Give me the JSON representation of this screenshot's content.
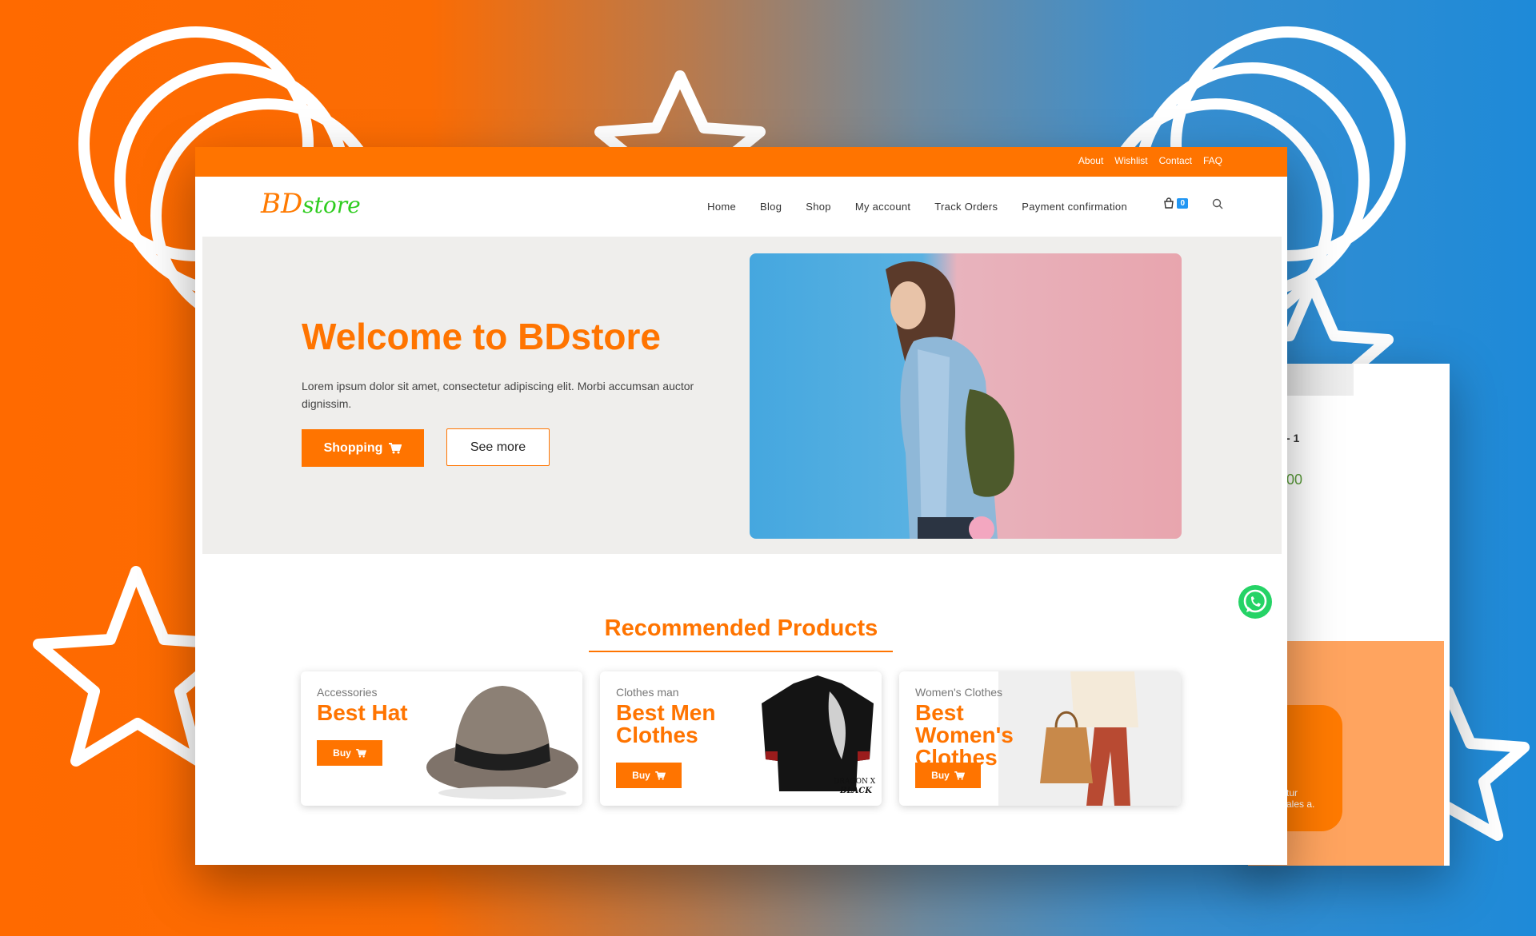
{
  "colors": {
    "brand": "#ff7400",
    "badge": "#2196f3",
    "logo_green": "#2ecc1f",
    "hero_bg": "#efeeec"
  },
  "topbar": {
    "links": [
      "About",
      "Wishlist",
      "Contact",
      "FAQ"
    ]
  },
  "logo": {
    "part1": "BD",
    "part2": "store"
  },
  "nav": {
    "items": [
      "Home",
      "Blog",
      "Shop",
      "My account",
      "Track Orders",
      "Payment confirmation"
    ],
    "cart_count": "0",
    "cart_icon": "shopping-bag-icon",
    "search_icon": "search-icon"
  },
  "hero": {
    "title": "Welcome to BDstore",
    "text": "Lorem ipsum dolor sit amet, consectetur adipiscing elit. Morbi accumsan auctor dignissim.",
    "shop_label": "Shopping",
    "more_label": "See more"
  },
  "recommended": {
    "title": "Recommended Products",
    "products": [
      {
        "category": "Accessories",
        "name": "Best Hat",
        "buy": "Buy"
      },
      {
        "category": "Clothes man",
        "name": "Best Men Clothes",
        "buy": "Buy"
      },
      {
        "category": "Women's Clothes",
        "name": "Best Women's Clothes",
        "buy": "Buy"
      }
    ],
    "shirt_brand_line1": "DRAGON X",
    "shirt_brand_line2": "BLACK"
  },
  "back_card": {
    "peek_a": "- 1",
    "peek_b": "00",
    "peek_c1": "tur",
    "peek_c2": "ales a."
  }
}
